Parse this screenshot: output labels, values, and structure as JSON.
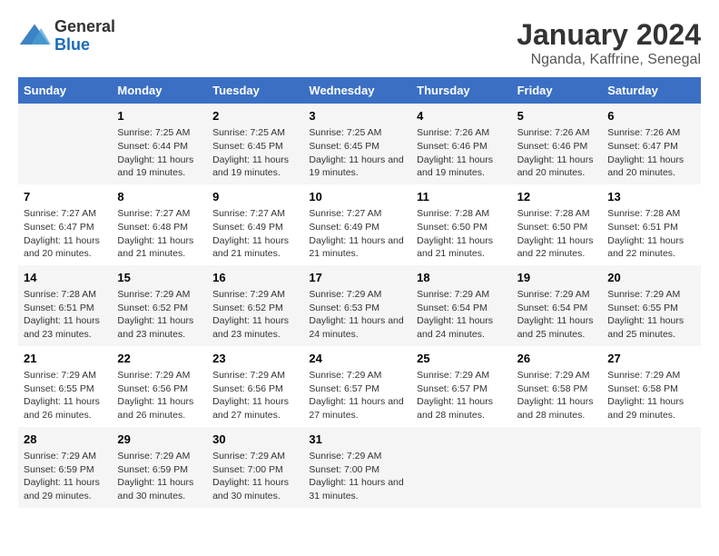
{
  "header": {
    "logo_general": "General",
    "logo_blue": "Blue",
    "title": "January 2024",
    "subtitle": "Nganda, Kaffrine, Senegal"
  },
  "days_of_week": [
    "Sunday",
    "Monday",
    "Tuesday",
    "Wednesday",
    "Thursday",
    "Friday",
    "Saturday"
  ],
  "weeks": [
    [
      {
        "day": "",
        "sunrise": "",
        "sunset": "",
        "daylight": ""
      },
      {
        "day": "1",
        "sunrise": "Sunrise: 7:25 AM",
        "sunset": "Sunset: 6:44 PM",
        "daylight": "Daylight: 11 hours and 19 minutes."
      },
      {
        "day": "2",
        "sunrise": "Sunrise: 7:25 AM",
        "sunset": "Sunset: 6:45 PM",
        "daylight": "Daylight: 11 hours and 19 minutes."
      },
      {
        "day": "3",
        "sunrise": "Sunrise: 7:25 AM",
        "sunset": "Sunset: 6:45 PM",
        "daylight": "Daylight: 11 hours and 19 minutes."
      },
      {
        "day": "4",
        "sunrise": "Sunrise: 7:26 AM",
        "sunset": "Sunset: 6:46 PM",
        "daylight": "Daylight: 11 hours and 19 minutes."
      },
      {
        "day": "5",
        "sunrise": "Sunrise: 7:26 AM",
        "sunset": "Sunset: 6:46 PM",
        "daylight": "Daylight: 11 hours and 20 minutes."
      },
      {
        "day": "6",
        "sunrise": "Sunrise: 7:26 AM",
        "sunset": "Sunset: 6:47 PM",
        "daylight": "Daylight: 11 hours and 20 minutes."
      }
    ],
    [
      {
        "day": "7",
        "sunrise": "Sunrise: 7:27 AM",
        "sunset": "Sunset: 6:47 PM",
        "daylight": "Daylight: 11 hours and 20 minutes."
      },
      {
        "day": "8",
        "sunrise": "Sunrise: 7:27 AM",
        "sunset": "Sunset: 6:48 PM",
        "daylight": "Daylight: 11 hours and 21 minutes."
      },
      {
        "day": "9",
        "sunrise": "Sunrise: 7:27 AM",
        "sunset": "Sunset: 6:49 PM",
        "daylight": "Daylight: 11 hours and 21 minutes."
      },
      {
        "day": "10",
        "sunrise": "Sunrise: 7:27 AM",
        "sunset": "Sunset: 6:49 PM",
        "daylight": "Daylight: 11 hours and 21 minutes."
      },
      {
        "day": "11",
        "sunrise": "Sunrise: 7:28 AM",
        "sunset": "Sunset: 6:50 PM",
        "daylight": "Daylight: 11 hours and 21 minutes."
      },
      {
        "day": "12",
        "sunrise": "Sunrise: 7:28 AM",
        "sunset": "Sunset: 6:50 PM",
        "daylight": "Daylight: 11 hours and 22 minutes."
      },
      {
        "day": "13",
        "sunrise": "Sunrise: 7:28 AM",
        "sunset": "Sunset: 6:51 PM",
        "daylight": "Daylight: 11 hours and 22 minutes."
      }
    ],
    [
      {
        "day": "14",
        "sunrise": "Sunrise: 7:28 AM",
        "sunset": "Sunset: 6:51 PM",
        "daylight": "Daylight: 11 hours and 23 minutes."
      },
      {
        "day": "15",
        "sunrise": "Sunrise: 7:29 AM",
        "sunset": "Sunset: 6:52 PM",
        "daylight": "Daylight: 11 hours and 23 minutes."
      },
      {
        "day": "16",
        "sunrise": "Sunrise: 7:29 AM",
        "sunset": "Sunset: 6:52 PM",
        "daylight": "Daylight: 11 hours and 23 minutes."
      },
      {
        "day": "17",
        "sunrise": "Sunrise: 7:29 AM",
        "sunset": "Sunset: 6:53 PM",
        "daylight": "Daylight: 11 hours and 24 minutes."
      },
      {
        "day": "18",
        "sunrise": "Sunrise: 7:29 AM",
        "sunset": "Sunset: 6:54 PM",
        "daylight": "Daylight: 11 hours and 24 minutes."
      },
      {
        "day": "19",
        "sunrise": "Sunrise: 7:29 AM",
        "sunset": "Sunset: 6:54 PM",
        "daylight": "Daylight: 11 hours and 25 minutes."
      },
      {
        "day": "20",
        "sunrise": "Sunrise: 7:29 AM",
        "sunset": "Sunset: 6:55 PM",
        "daylight": "Daylight: 11 hours and 25 minutes."
      }
    ],
    [
      {
        "day": "21",
        "sunrise": "Sunrise: 7:29 AM",
        "sunset": "Sunset: 6:55 PM",
        "daylight": "Daylight: 11 hours and 26 minutes."
      },
      {
        "day": "22",
        "sunrise": "Sunrise: 7:29 AM",
        "sunset": "Sunset: 6:56 PM",
        "daylight": "Daylight: 11 hours and 26 minutes."
      },
      {
        "day": "23",
        "sunrise": "Sunrise: 7:29 AM",
        "sunset": "Sunset: 6:56 PM",
        "daylight": "Daylight: 11 hours and 27 minutes."
      },
      {
        "day": "24",
        "sunrise": "Sunrise: 7:29 AM",
        "sunset": "Sunset: 6:57 PM",
        "daylight": "Daylight: 11 hours and 27 minutes."
      },
      {
        "day": "25",
        "sunrise": "Sunrise: 7:29 AM",
        "sunset": "Sunset: 6:57 PM",
        "daylight": "Daylight: 11 hours and 28 minutes."
      },
      {
        "day": "26",
        "sunrise": "Sunrise: 7:29 AM",
        "sunset": "Sunset: 6:58 PM",
        "daylight": "Daylight: 11 hours and 28 minutes."
      },
      {
        "day": "27",
        "sunrise": "Sunrise: 7:29 AM",
        "sunset": "Sunset: 6:58 PM",
        "daylight": "Daylight: 11 hours and 29 minutes."
      }
    ],
    [
      {
        "day": "28",
        "sunrise": "Sunrise: 7:29 AM",
        "sunset": "Sunset: 6:59 PM",
        "daylight": "Daylight: 11 hours and 29 minutes."
      },
      {
        "day": "29",
        "sunrise": "Sunrise: 7:29 AM",
        "sunset": "Sunset: 6:59 PM",
        "daylight": "Daylight: 11 hours and 30 minutes."
      },
      {
        "day": "30",
        "sunrise": "Sunrise: 7:29 AM",
        "sunset": "Sunset: 7:00 PM",
        "daylight": "Daylight: 11 hours and 30 minutes."
      },
      {
        "day": "31",
        "sunrise": "Sunrise: 7:29 AM",
        "sunset": "Sunset: 7:00 PM",
        "daylight": "Daylight: 11 hours and 31 minutes."
      },
      {
        "day": "",
        "sunrise": "",
        "sunset": "",
        "daylight": ""
      },
      {
        "day": "",
        "sunrise": "",
        "sunset": "",
        "daylight": ""
      },
      {
        "day": "",
        "sunrise": "",
        "sunset": "",
        "daylight": ""
      }
    ]
  ]
}
